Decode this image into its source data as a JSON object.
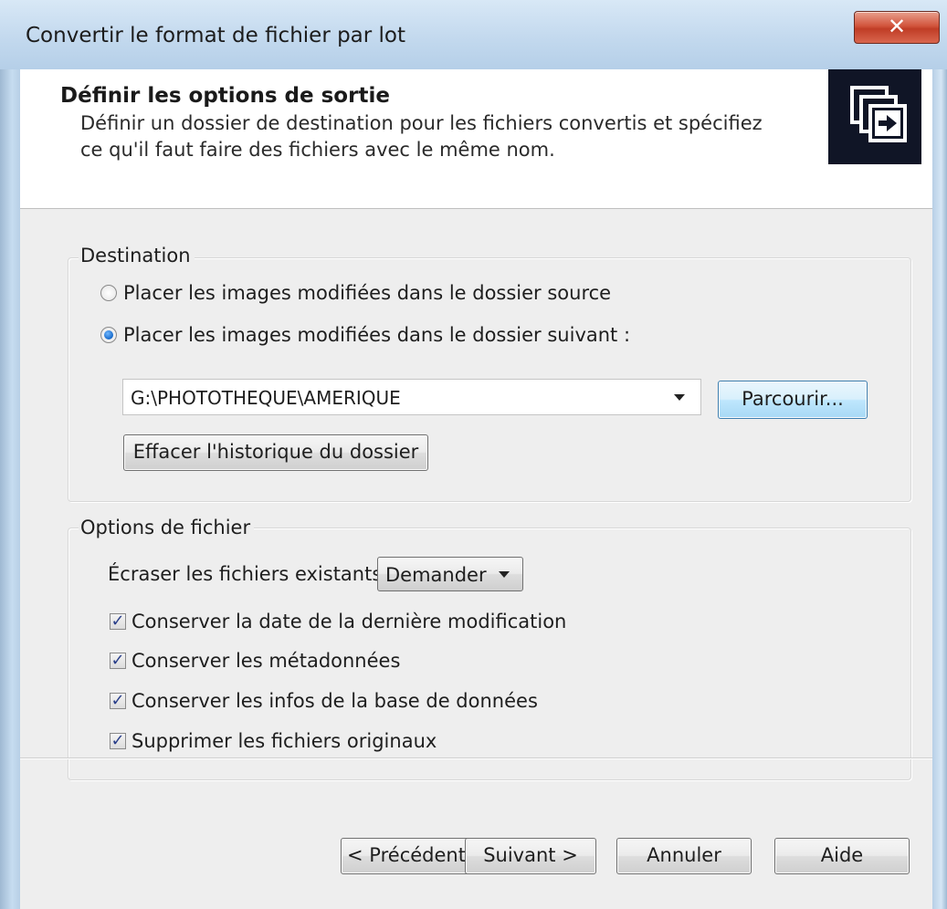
{
  "window": {
    "title": "Convertir le format de fichier par lot",
    "close_label": "✕"
  },
  "header": {
    "title": "Définir les options de sortie",
    "description": "Définir un dossier de destination pour les fichiers convertis et spécifiez ce qu'il faut faire des fichiers avec le même nom."
  },
  "destination": {
    "label": "Destination",
    "option_source": "Placer les images modifiées dans le dossier source",
    "option_folder": "Placer les images modifiées dans le dossier suivant :",
    "selected": "option_folder",
    "folder_path": "G:\\PHOTOTHEQUE\\AMERIQUE",
    "browse_label": "Parcourir...",
    "clear_history_label": "Effacer l'historique du dossier"
  },
  "file_options": {
    "label": "Options de fichier",
    "overwrite_label": "Écraser les fichiers existants :",
    "overwrite_value": "Demander",
    "checkboxes": [
      {
        "label": "Conserver la date de la dernière modification",
        "checked": true
      },
      {
        "label": "Conserver les métadonnées",
        "checked": true
      },
      {
        "label": "Conserver les infos de la base de données",
        "checked": true
      },
      {
        "label": "Supprimer les fichiers originaux",
        "checked": true
      }
    ]
  },
  "footer": {
    "back_label": "< Précédent",
    "next_label": "Suivant >",
    "cancel_label": "Annuler",
    "help_label": "Aide"
  },
  "colors": {
    "frame": "#a9c4dc",
    "close_button": "#c03d26",
    "header_icon_bg": "#101526",
    "default_button_border": "#3c7fb1"
  }
}
